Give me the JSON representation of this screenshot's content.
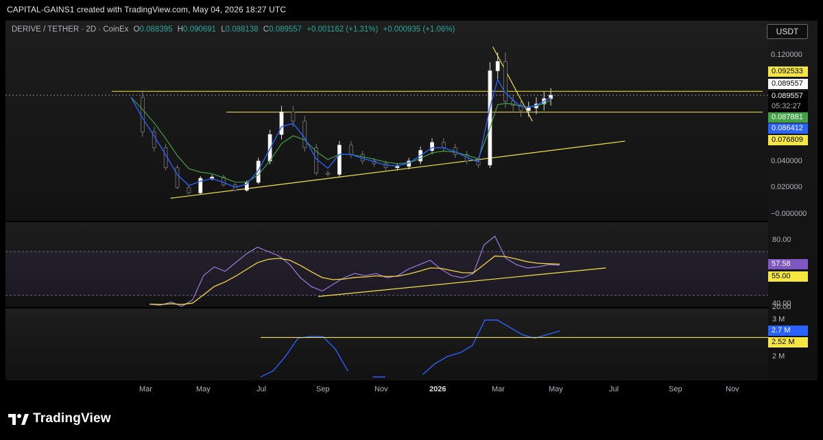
{
  "header": {
    "attribution": "CAPITAL-GAINS1 created with TradingView.com, May 04, 2026 18:27 UTC"
  },
  "symbol": {
    "name": "DERIVE / TETHER · 2D · CoinEx",
    "open_label": "O",
    "open": "0.088395",
    "high_label": "H",
    "high": "0.090691",
    "low_label": "L",
    "low": "0.088138",
    "close_label": "C",
    "close": "0.089557",
    "change": "+0.001162 (+1.31%)",
    "change2": "+0.000935 (+1.06%)"
  },
  "currency_button": "USDT",
  "price_scale": {
    "ticks": [
      "0.120000",
      "0.040000",
      "0.020000",
      "−0.000000"
    ],
    "tags": [
      {
        "text": "0.092533",
        "color": "#f5e642",
        "text_color": "#000000"
      },
      {
        "text": "0.089557",
        "color": "#ffffff",
        "text_color": "#000000"
      },
      {
        "text": "0.089557",
        "color": "#000000",
        "text_color": "#ffffff"
      },
      {
        "text": "05:32:27",
        "color": "#000000",
        "text_color": "#b2b5be"
      },
      {
        "text": "0.087881",
        "color": "#43a047",
        "text_color": "#ffffff"
      },
      {
        "text": "0.086412",
        "color": "#2962ff",
        "text_color": "#ffffff"
      },
      {
        "text": "0.076809",
        "color": "#f5e642",
        "text_color": "#000000"
      }
    ]
  },
  "rsi_scale": {
    "ticks": [
      "80.00",
      "40.00",
      "20.00"
    ],
    "tags": [
      {
        "text": "57.58",
        "color": "#7e57c2",
        "text_color": "#ffffff"
      },
      {
        "text": "55.00",
        "color": "#f5e642",
        "text_color": "#000000"
      }
    ]
  },
  "vol_scale": {
    "ticks": [
      "3 M",
      "2 M"
    ],
    "tags": [
      {
        "text": "2.7 M",
        "color": "#2962ff",
        "text_color": "#ffffff"
      },
      {
        "text": "2.52 M",
        "color": "#f5e642",
        "text_color": "#000000"
      }
    ]
  },
  "time_axis": [
    "Mar",
    "May",
    "Jul",
    "Sep",
    "Nov",
    "2026",
    "Mar",
    "May",
    "Jul",
    "Sep",
    "Nov"
  ],
  "brand": "TradingView",
  "chart_data": {
    "type": "candlestick",
    "title": "",
    "xlabel": "",
    "ylabel": "",
    "ylim": [
      0,
      0.13
    ],
    "grid": false,
    "interval": "2D",
    "x_range": [
      "2025-02-01",
      "2026-12-01"
    ],
    "close_series": {
      "dates": [
        "2025-02-23",
        "2025-03-07",
        "2025-03-19",
        "2025-03-31",
        "2025-04-12",
        "2025-04-24",
        "2025-05-06",
        "2025-05-18",
        "2025-05-30",
        "2025-06-11",
        "2025-06-23",
        "2025-07-05",
        "2025-07-17",
        "2025-07-29",
        "2025-08-10",
        "2025-08-22",
        "2025-09-03",
        "2025-09-15",
        "2025-09-27",
        "2025-10-09",
        "2025-10-21",
        "2025-11-02",
        "2025-11-14",
        "2025-11-26",
        "2025-12-08",
        "2025-12-20",
        "2026-01-01",
        "2026-01-13",
        "2026-01-25",
        "2026-02-06",
        "2026-02-18",
        "2026-03-02",
        "2026-03-10",
        "2026-03-18",
        "2026-03-26",
        "2026-04-03",
        "2026-04-11",
        "2026-04-19",
        "2026-04-27",
        "2026-05-04"
      ],
      "values": [
        0.088,
        0.062,
        0.05,
        0.035,
        0.02,
        0.016,
        0.027,
        0.028,
        0.022,
        0.018,
        0.024,
        0.04,
        0.06,
        0.077,
        0.07,
        0.05,
        0.031,
        0.03,
        0.052,
        0.045,
        0.04,
        0.038,
        0.035,
        0.036,
        0.04,
        0.048,
        0.054,
        0.05,
        0.045,
        0.04,
        0.037,
        0.108,
        0.115,
        0.085,
        0.082,
        0.078,
        0.08,
        0.083,
        0.087,
        0.0896
      ]
    },
    "ema_fast": {
      "name": "",
      "color": "#2962ff",
      "last": 0.086412
    },
    "ema_slow": {
      "name": "",
      "color": "#43a047",
      "last": 0.087881
    },
    "levels": [
      {
        "type": "horizontal",
        "value": 0.092533,
        "color": "#f5e642"
      },
      {
        "type": "horizontal",
        "value": 0.076809,
        "color": "#f5e642"
      },
      {
        "type": "trendline",
        "from": [
          "2025-04-05",
          0.012
        ],
        "to": [
          "2026-07-20",
          0.055
        ],
        "color": "#f5e642"
      },
      {
        "type": "trendline",
        "from": [
          "2026-03-05",
          0.126
        ],
        "to": [
          "2026-04-15",
          0.07
        ],
        "color": "#f5e642"
      }
    ],
    "rsi": {
      "ylim": [
        20,
        90
      ],
      "bands": [
        70,
        30
      ],
      "last": 57.58,
      "ma_last": 55.0,
      "values": [
        22,
        21,
        24,
        20,
        26,
        48,
        56,
        52,
        60,
        68,
        74,
        70,
        66,
        58,
        46,
        38,
        34,
        40,
        46,
        50,
        48,
        50,
        46,
        48,
        54,
        58,
        62,
        54,
        48,
        46,
        50,
        76,
        84,
        64,
        58,
        55,
        56,
        58,
        57.58
      ],
      "trendline": {
        "from": [
          "2025-09-05",
          29
        ],
        "to": [
          "2026-06-30",
          55
        ],
        "color": "#f5e642"
      }
    },
    "volume_ma": {
      "last": "2.7 M",
      "level": "2.52 M",
      "values": [
        1.4,
        1.6,
        2.0,
        2.5,
        2.55,
        2.55,
        2.2,
        1.6,
        null,
        1.4,
        1.3,
        null,
        null,
        1.5,
        1.8,
        2.0,
        2.1,
        2.3,
        3.0,
        3.0,
        2.8,
        2.6,
        2.5,
        2.6,
        2.7
      ]
    }
  }
}
